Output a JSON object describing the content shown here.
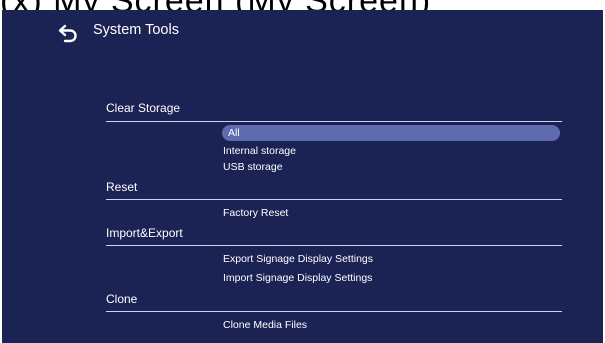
{
  "page_caption": "(x) My Screen (My Screen)",
  "header": {
    "title": "System Tools",
    "back_icon": "back-arrow-icon"
  },
  "colors": {
    "background": "#1b2254",
    "selected": "#5e6bb0",
    "text": "#ffffff"
  },
  "sections": {
    "clear_storage": {
      "label": "Clear Storage",
      "options": [
        "All",
        "Internal storage",
        "USB storage"
      ],
      "selected": "All"
    },
    "reset": {
      "label": "Reset",
      "options": [
        "Factory Reset"
      ]
    },
    "import_export": {
      "label": "Import&Export",
      "options": [
        "Export Signage Display Settings",
        "Import Signage Display Settings"
      ]
    },
    "clone": {
      "label": "Clone",
      "options": [
        "Clone Media Files"
      ]
    }
  }
}
